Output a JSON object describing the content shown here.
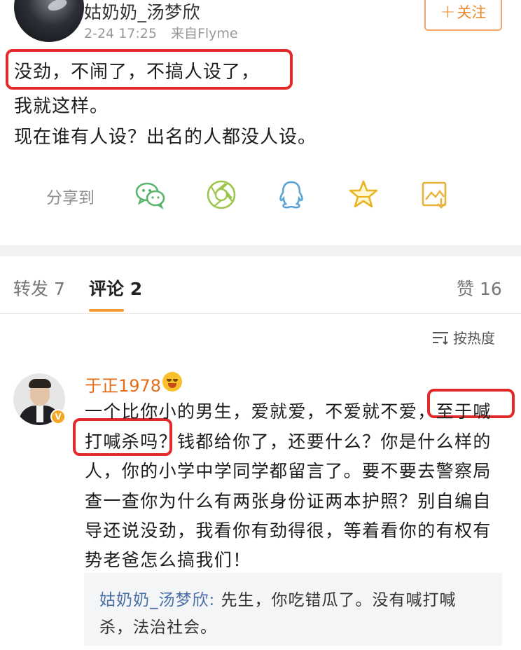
{
  "post": {
    "username": "姑奶奶_汤梦欣",
    "timestamp": "2-24 17:25",
    "source": "来自Flyme",
    "follow_label": "关注",
    "text_lines": [
      "没劲，不闹了，不搞人设了，",
      "我就这样。",
      "现在谁有人设？出名的人都没人设。"
    ]
  },
  "share": {
    "label": "分享到",
    "icons": [
      "wechat-icon",
      "moments-icon",
      "qq-icon",
      "qzone-star-icon",
      "save-image-icon"
    ]
  },
  "tabs": {
    "repost": "转发 7",
    "comments": "评论 2",
    "likes": "赞 16"
  },
  "sort_label": "按热度",
  "comment": {
    "username": "于正1978",
    "verified_badge": "V",
    "lines": [
      "一个比你小的男生，爱就爱，不爱就不爱，至于喊",
      "打喊杀吗？钱都给你了，还要什么？你是什么样的",
      "人，你的小学中学同学都留言了。要不要去警察局",
      "查一查你为什么有两张身份证两本护照？别自编自",
      "导还说没劲，我看你有劲得很，等着看你的有权有",
      "势老爸怎么搞我们！"
    ],
    "reply": {
      "username": "姑奶奶_汤梦欣:",
      "line1": " 先生，你吃错瓜了。没有喊打喊",
      "line2": "杀，法治社会。"
    }
  },
  "colors": {
    "accent_orange": "#f29b33",
    "username_orange": "#e66d17",
    "highlight_red": "#e32a2a",
    "reply_user_blue": "#4a6fa5"
  }
}
